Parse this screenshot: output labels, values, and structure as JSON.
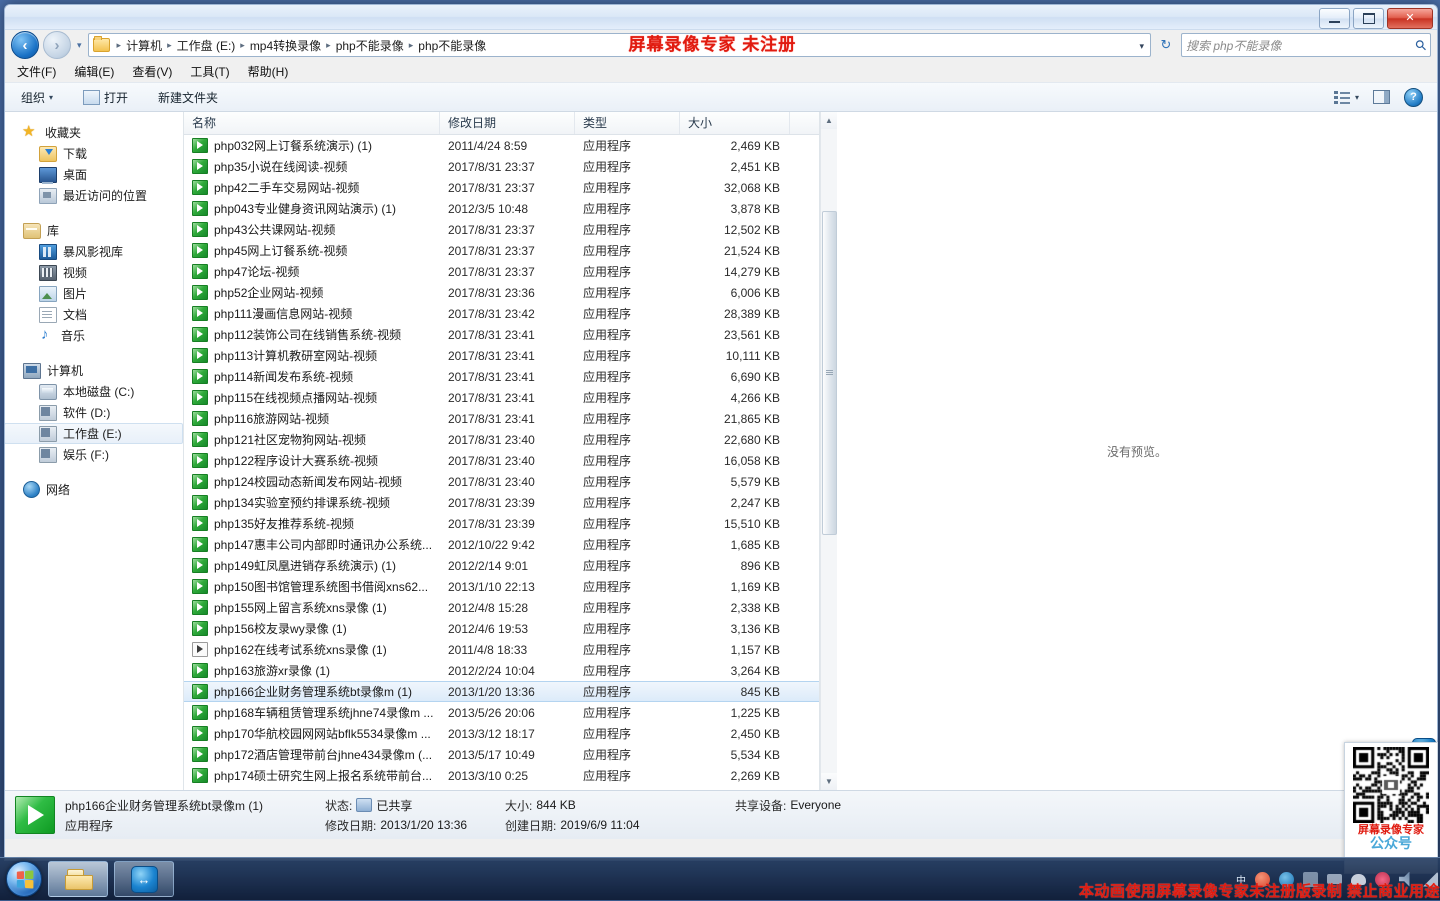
{
  "window": {
    "controls": {
      "minimize": "—",
      "maximize": "▫",
      "close": "✕"
    }
  },
  "address": {
    "back_label": "◀",
    "forward_label": "▶",
    "dropdown_caret": "▾",
    "breadcrumbs": [
      "计算机",
      "工作盘 (E:)",
      "mp4转换录像",
      "php不能录像",
      "php不能录像"
    ],
    "separator": "▸",
    "caret": "▾",
    "refresh_label": "↻",
    "watermark": "屏幕录像专家  未注册"
  },
  "search": {
    "placeholder": "搜索 php不能录像",
    "icon": "⌕"
  },
  "menubar": [
    "文件(F)",
    "编辑(E)",
    "查看(V)",
    "工具(T)",
    "帮助(H)"
  ],
  "toolbar": {
    "organize": "组织",
    "organize_caret": "▾",
    "open": "打开",
    "new_folder": "新建文件夹",
    "help_glyph": "?"
  },
  "navpane": {
    "groups": [
      {
        "head": "收藏夹",
        "head_icon": "star-icon",
        "items": [
          {
            "label": "下载",
            "icon": "downloads-icon"
          },
          {
            "label": "桌面",
            "icon": "desktop-icon"
          },
          {
            "label": "最近访问的位置",
            "icon": "recent-places-icon"
          }
        ]
      },
      {
        "head": "库",
        "head_icon": "library-icon",
        "items": [
          {
            "label": "暴风影视库",
            "icon": "baofeng-video-icon"
          },
          {
            "label": "视频",
            "icon": "videos-icon"
          },
          {
            "label": "图片",
            "icon": "pictures-icon"
          },
          {
            "label": "文档",
            "icon": "documents-icon"
          },
          {
            "label": "音乐",
            "icon": "music-icon"
          }
        ]
      },
      {
        "head": "计算机",
        "head_icon": "computer-icon",
        "items": [
          {
            "label": "本地磁盘 (C:)",
            "icon": "local-disk-icon",
            "selected": false
          },
          {
            "label": "软件 (D:)",
            "icon": "drive-icon",
            "selected": false
          },
          {
            "label": "工作盘 (E:)",
            "icon": "drive-icon",
            "selected": true
          },
          {
            "label": "娱乐 (F:)",
            "icon": "drive-icon",
            "selected": false
          }
        ]
      },
      {
        "head": "网络",
        "head_icon": "network-icon",
        "items": []
      }
    ]
  },
  "filelist": {
    "columns": [
      "名称",
      "修改日期",
      "类型",
      "大小"
    ],
    "rows": [
      {
        "name": "php032网上订餐系统演示) (1)",
        "date": "2011/4/24 8:59",
        "type": "应用程序",
        "size": "2,469 KB"
      },
      {
        "name": "php35小说在线阅读-视频",
        "date": "2017/8/31 23:37",
        "type": "应用程序",
        "size": "2,451 KB"
      },
      {
        "name": "php42二手车交易网站-视频",
        "date": "2017/8/31 23:37",
        "type": "应用程序",
        "size": "32,068 KB"
      },
      {
        "name": "php043专业健身资讯网站演示) (1)",
        "date": "2012/3/5 10:48",
        "type": "应用程序",
        "size": "3,878 KB"
      },
      {
        "name": "php43公共课网站-视频",
        "date": "2017/8/31 23:37",
        "type": "应用程序",
        "size": "12,502 KB"
      },
      {
        "name": "php45网上订餐系统-视频",
        "date": "2017/8/31 23:37",
        "type": "应用程序",
        "size": "21,524 KB"
      },
      {
        "name": "php47论坛-视频",
        "date": "2017/8/31 23:37",
        "type": "应用程序",
        "size": "14,279 KB"
      },
      {
        "name": "php52企业网站-视频",
        "date": "2017/8/31 23:36",
        "type": "应用程序",
        "size": "6,006 KB"
      },
      {
        "name": "php111漫画信息网站-视频",
        "date": "2017/8/31 23:42",
        "type": "应用程序",
        "size": "28,389 KB"
      },
      {
        "name": "php112装饰公司在线销售系统-视频",
        "date": "2017/8/31 23:41",
        "type": "应用程序",
        "size": "23,561 KB"
      },
      {
        "name": "php113计算机教研室网站-视频",
        "date": "2017/8/31 23:41",
        "type": "应用程序",
        "size": "10,111 KB"
      },
      {
        "name": "php114新闻发布系统-视频",
        "date": "2017/8/31 23:41",
        "type": "应用程序",
        "size": "6,690 KB"
      },
      {
        "name": "php115在线视频点播网站-视频",
        "date": "2017/8/31 23:41",
        "type": "应用程序",
        "size": "4,266 KB"
      },
      {
        "name": "php116旅游网站-视频",
        "date": "2017/8/31 23:41",
        "type": "应用程序",
        "size": "21,865 KB"
      },
      {
        "name": "php121社区宠物狗网站-视频",
        "date": "2017/8/31 23:40",
        "type": "应用程序",
        "size": "22,680 KB"
      },
      {
        "name": "php122程序设计大赛系统-视频",
        "date": "2017/8/31 23:40",
        "type": "应用程序",
        "size": "16,058 KB"
      },
      {
        "name": "php124校园动态新闻发布网站-视频",
        "date": "2017/8/31 23:40",
        "type": "应用程序",
        "size": "5,579 KB"
      },
      {
        "name": "php134实验室预约排课系统-视频",
        "date": "2017/8/31 23:39",
        "type": "应用程序",
        "size": "2,247 KB"
      },
      {
        "name": "php135好友推荐系统-视频",
        "date": "2017/8/31 23:39",
        "type": "应用程序",
        "size": "15,510 KB"
      },
      {
        "name": "php147惠丰公司内部即时通讯办公系统...",
        "date": "2012/10/22 9:42",
        "type": "应用程序",
        "size": "1,685 KB"
      },
      {
        "name": "php149虹凤凰进销存系统演示) (1)",
        "date": "2012/2/14 9:01",
        "type": "应用程序",
        "size": "896 KB"
      },
      {
        "name": "php150图书馆管理系统图书借阅xns62...",
        "date": "2013/1/10 22:13",
        "type": "应用程序",
        "size": "1,169 KB"
      },
      {
        "name": "php155网上留言系统xns录像 (1)",
        "date": "2012/4/8 15:28",
        "type": "应用程序",
        "size": "2,338 KB"
      },
      {
        "name": "php156校友录wy录像 (1)",
        "date": "2012/4/6 19:53",
        "type": "应用程序",
        "size": "3,136 KB"
      },
      {
        "name": "php162在线考试系统xns录像 (1)",
        "date": "2011/4/8 18:33",
        "type": "应用程序",
        "size": "1,157 KB",
        "icon_variant": "alt"
      },
      {
        "name": "php163旅游xr录像 (1)",
        "date": "2012/2/24 10:04",
        "type": "应用程序",
        "size": "3,264 KB"
      },
      {
        "name": "php166企业财务管理系统bt录像m (1)",
        "date": "2013/1/20 13:36",
        "type": "应用程序",
        "size": "845 KB",
        "selected": true
      },
      {
        "name": "php168车辆租赁管理系统jhne74录像m ...",
        "date": "2013/5/26 20:06",
        "type": "应用程序",
        "size": "1,225 KB"
      },
      {
        "name": "php170华航校园网网站bflk5534录像m ...",
        "date": "2013/3/12 18:17",
        "type": "应用程序",
        "size": "2,450 KB"
      },
      {
        "name": "php172酒店管理带前台jhne434录像m (...",
        "date": "2013/5/17 10:49",
        "type": "应用程序",
        "size": "5,534 KB"
      },
      {
        "name": "php174硕士研究生网上报名系统带前台...",
        "date": "2013/3/10 0:25",
        "type": "应用程序",
        "size": "2,269 KB"
      }
    ],
    "scroll_up": "▲",
    "scroll_down": "▼"
  },
  "preview": {
    "empty_text": "没有预览。"
  },
  "details": {
    "filename": "php166企业财务管理系统bt录像m (1)",
    "filetype": "应用程序",
    "status_label": "状态:",
    "status_value": "已共享",
    "size_label": "大小:",
    "size_value": "844 KB",
    "shared_label": "共享设备:",
    "shared_value": "Everyone",
    "modified_label": "修改日期:",
    "modified_value": "2013/1/20 13:36",
    "created_label": "创建日期:",
    "created_value": "2019/6/9 11:04"
  },
  "taskbar": {
    "start_label": "开始",
    "buttons": [
      {
        "name": "explorer",
        "active": true
      },
      {
        "name": "teamviewer",
        "active": false,
        "glyph": "↔"
      }
    ],
    "tray_time": ""
  },
  "watermarks": {
    "bottom": "本动画使用屏幕录像专家未注册版录制 禁止商业用途",
    "qr_line1": "屏幕录像专家",
    "qr_line2": "公众号",
    "float_glyph": "↔"
  },
  "colors": {
    "accent": "#1f63b5",
    "watermark_red": "#e01b10",
    "exe_green": "#16892a",
    "selection": "#dcebfa"
  }
}
